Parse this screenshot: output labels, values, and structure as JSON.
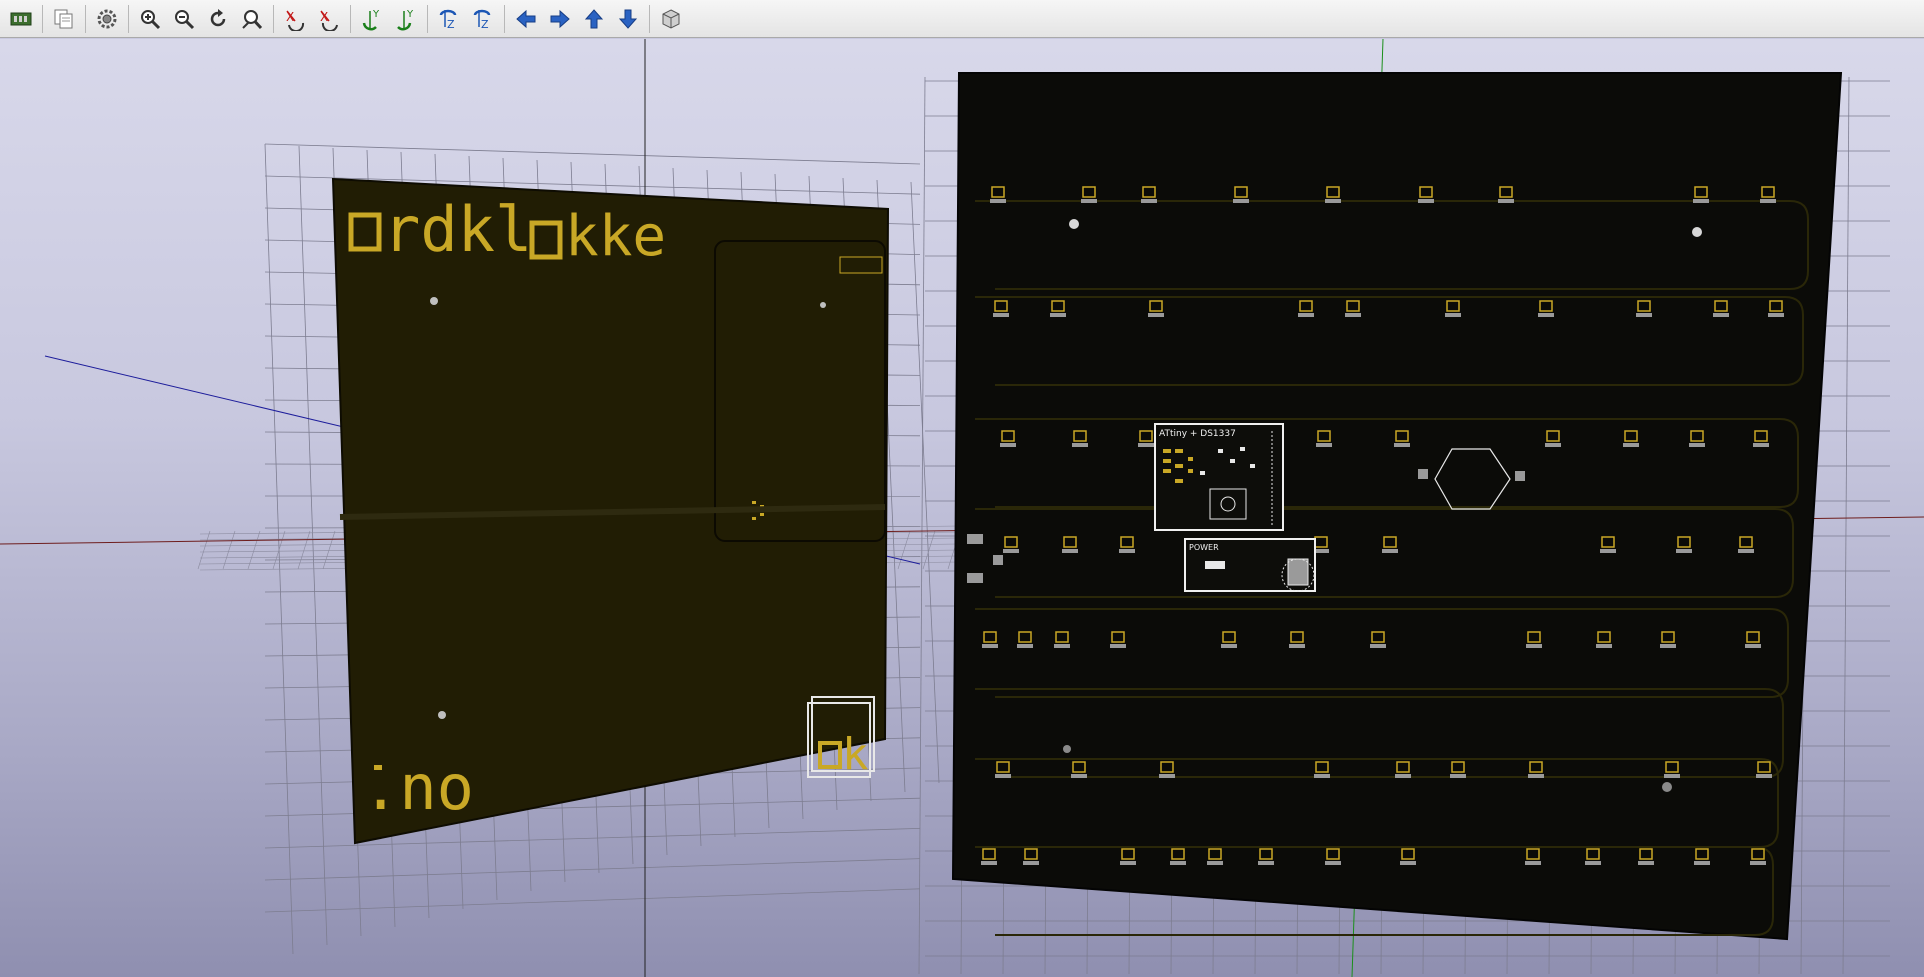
{
  "toolbar": {
    "buttons": [
      {
        "name": "reload-board-button",
        "icon": "board-reload-icon"
      },
      {
        "name": "copy-image-button",
        "icon": "copy-icon"
      },
      {
        "name": "settings-button",
        "icon": "gear-icon"
      },
      {
        "name": "zoom-in-button",
        "icon": "zoom-in-icon"
      },
      {
        "name": "zoom-out-button",
        "icon": "zoom-out-icon"
      },
      {
        "name": "redraw-button",
        "icon": "redraw-icon"
      },
      {
        "name": "zoom-fit-button",
        "icon": "zoom-fit-icon"
      },
      {
        "name": "rotate-x-cw-button",
        "icon": "rotate-x-cw-icon"
      },
      {
        "name": "rotate-x-ccw-button",
        "icon": "rotate-x-ccw-icon"
      },
      {
        "name": "rotate-y-cw-button",
        "icon": "rotate-y-cw-icon"
      },
      {
        "name": "rotate-y-ccw-button",
        "icon": "rotate-y-ccw-icon"
      },
      {
        "name": "rotate-z-cw-button",
        "icon": "rotate-z-cw-icon"
      },
      {
        "name": "rotate-z-ccw-button",
        "icon": "rotate-z-ccw-icon"
      },
      {
        "name": "move-left-button",
        "icon": "arrow-left-icon"
      },
      {
        "name": "move-right-button",
        "icon": "arrow-right-icon"
      },
      {
        "name": "move-up-button",
        "icon": "arrow-up-icon"
      },
      {
        "name": "move-down-button",
        "icon": "arrow-down-icon"
      },
      {
        "name": "ortho-view-button",
        "icon": "cube-icon"
      }
    ]
  },
  "board_back": {
    "logo_text": "rdkl",
    "logo_text2": "kke",
    "logo_suffix": ".no",
    "corner_logo": "k"
  },
  "board_front": {
    "module1_label": "ATtiny + DS1337",
    "module2_label": "POWER"
  },
  "colors": {
    "toolbar_bg": "#ececec",
    "board_dark": "#211d04",
    "board_front": "#0b0b08",
    "silkscreen": "#c9a826",
    "grid_line": "#7d7d90",
    "axis_x": "#c81d1d",
    "axis_y": "#1a8f1a",
    "axis_z": "#1d1d9b"
  }
}
